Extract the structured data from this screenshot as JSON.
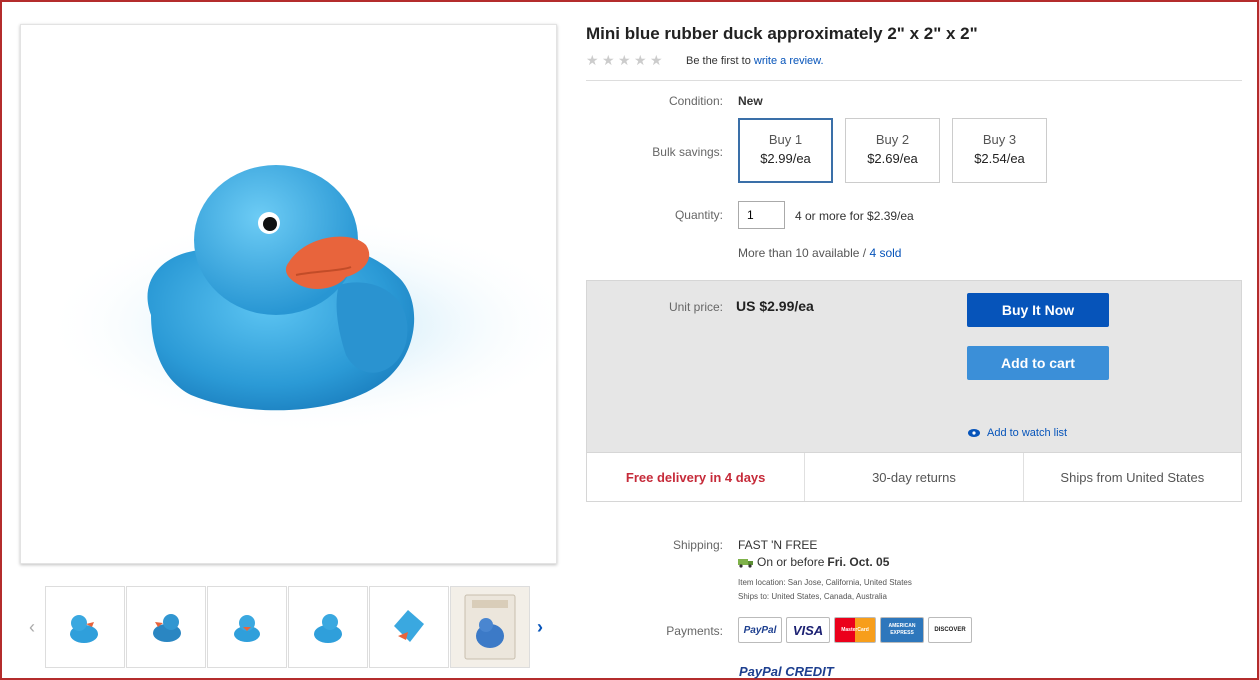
{
  "product": {
    "title": "Mini blue rubber duck approximately 2\" x 2\" x 2\"",
    "review_prefix": "Be the first to",
    "review_link": "write a review."
  },
  "condition": {
    "label": "Condition:",
    "value": "New"
  },
  "bulk": {
    "label": "Bulk savings:",
    "options": [
      {
        "qty": "Buy 1",
        "price": "$2.99/ea"
      },
      {
        "qty": "Buy 2",
        "price": "$2.69/ea"
      },
      {
        "qty": "Buy 3",
        "price": "$2.54/ea"
      }
    ]
  },
  "quantity": {
    "label": "Quantity:",
    "value": "1",
    "deal": "4 or more for $2.39/ea",
    "available": "More than 10 available /",
    "sold": "4 sold"
  },
  "buybox": {
    "unit_label": "Unit price:",
    "unit_value": "US $2.99/ea",
    "buy_now": "Buy It Now",
    "add_cart": "Add to cart",
    "watch": "Add to watch list"
  },
  "perks": [
    "Free delivery in 4 days",
    "30-day returns",
    "Ships from United States"
  ],
  "shipping": {
    "label": "Shipping:",
    "service": "FAST 'N FREE",
    "eta_prefix": "On or before",
    "eta_date": "Fri. Oct. 05",
    "location": "Item location:  San Jose, California, United States",
    "ships_to": "Ships to:  United States, Canada, Australia"
  },
  "payments": {
    "label": "Payments:",
    "cards": [
      "PayPal",
      "VISA",
      "MasterCard",
      "AMERICAN EXPRESS",
      "DISCOVER"
    ],
    "paypal_credit": "PayPal CREDIT"
  },
  "colors": {
    "accent": "#0654ba",
    "cart": "#3b8fd8",
    "duck": "#3aa8e0",
    "beak": "#e8643c",
    "frame": "#b42c2c"
  },
  "icons": [
    "chevron-left-icon",
    "chevron-right-icon",
    "star-icon",
    "eye-icon",
    "truck-icon"
  ]
}
